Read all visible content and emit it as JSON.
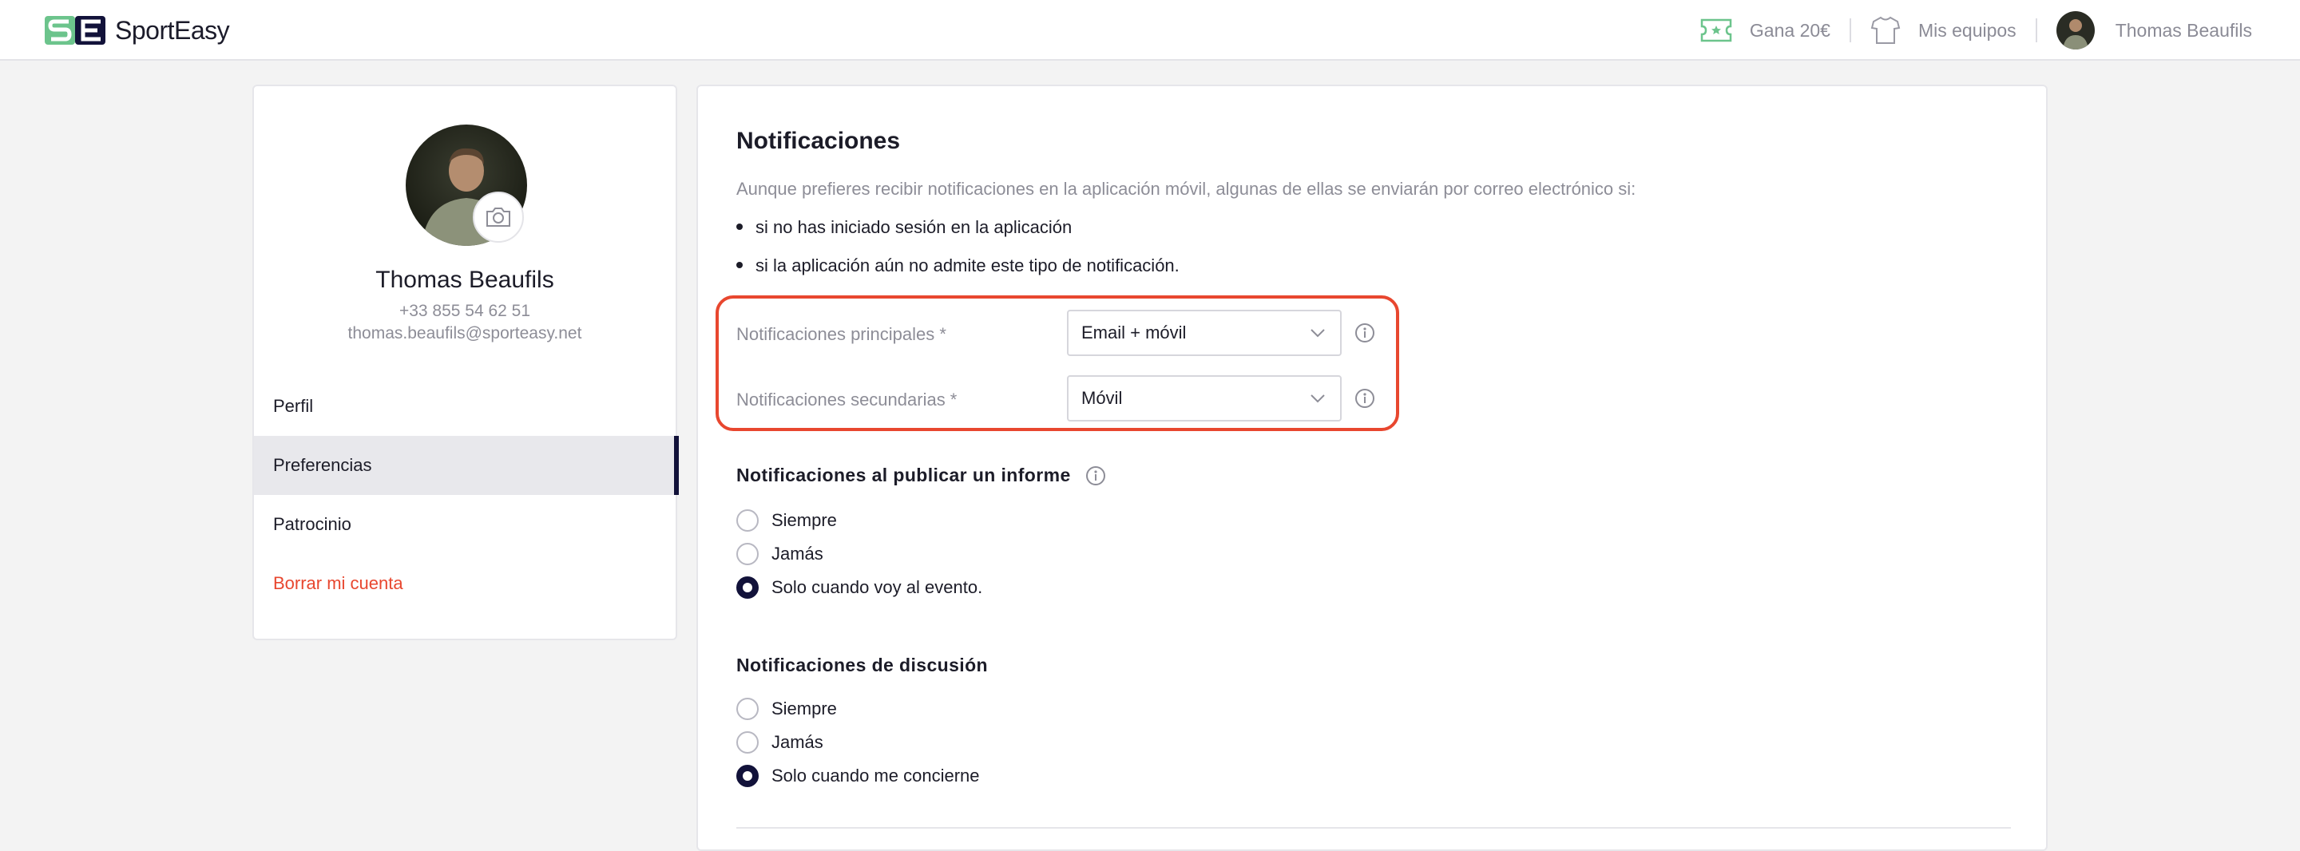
{
  "header": {
    "logo_text": "SportEasy",
    "earn_label": "Gana 20€",
    "teams_label": "Mis equipos",
    "user_name": "Thomas Beaufils"
  },
  "profile": {
    "name": "Thomas Beaufils",
    "phone": "+33 855 54 62 51",
    "email": "thomas.beaufils@sporteasy.net"
  },
  "sidebar": {
    "items": [
      {
        "label": "Perfil"
      },
      {
        "label": "Preferencias"
      },
      {
        "label": "Patrocinio"
      },
      {
        "label": "Borrar mi cuenta"
      }
    ]
  },
  "main": {
    "title": "Notificaciones",
    "intro": "Aunque prefieres recibir notificaciones en la aplicación móvil, algunas de ellas se enviarán por correo electrónico si:",
    "bullets": [
      "si no has iniciado sesión en la aplicación",
      "si la aplicación aún no admite este tipo de notificación."
    ],
    "fields": [
      {
        "label": "Notificaciones principales *",
        "value": "Email + móvil"
      },
      {
        "label": "Notificaciones secundarias *",
        "value": "Móvil"
      }
    ],
    "report_section": {
      "title": "Notificaciones al publicar un informe",
      "options": [
        "Siempre",
        "Jamás",
        "Solo cuando voy al evento."
      ],
      "selected": 2
    },
    "discussion_section": {
      "title": "Notificaciones de discusión",
      "options": [
        "Siempre",
        "Jamás",
        "Solo cuando me concierne"
      ],
      "selected": 2
    }
  },
  "colors": {
    "brand_green": "#6cc48c",
    "navy": "#12123a",
    "danger": "#e8472f",
    "muted": "#8d8d97"
  }
}
